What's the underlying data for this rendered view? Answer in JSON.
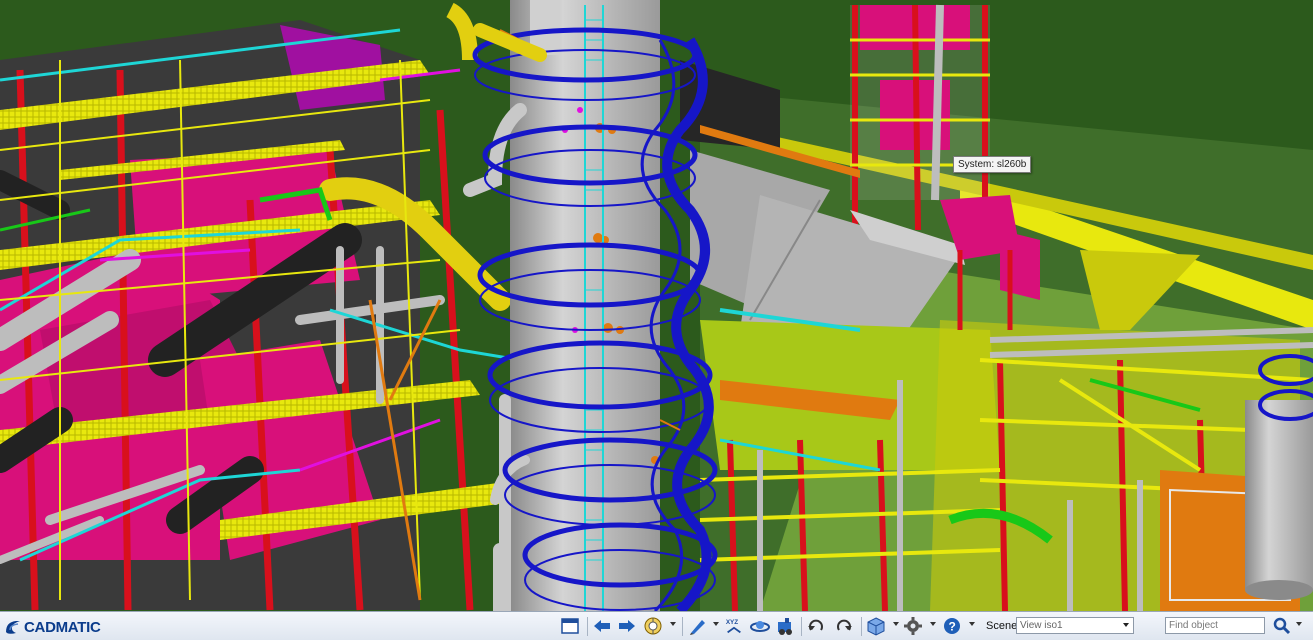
{
  "viewport": {
    "tooltip_text": "System: sl260b",
    "colors": {
      "background": "#2c5a1c",
      "ground": "#3f6e2a",
      "steel_red": "#d8101c",
      "equipment_magenta": "#d8107a",
      "platform_yellow": "#e8e80e",
      "handrail_blue": "#1616c8",
      "pipe_cyan": "#1ed6d6",
      "column_grey": "#b8b8b8",
      "walkway_orange": "#e08a1a"
    }
  },
  "statusbar": {
    "logo_text": "CADMATIC",
    "toolbar_icons": [
      "window-icon",
      "arrow-left-icon",
      "arrow-right-icon",
      "navigation-mode-icon",
      "measure-pen-icon",
      "xyz-coordinates-icon",
      "orbit-icon",
      "walk-icon",
      "undo-view-icon",
      "redo-view-icon",
      "object-box-icon",
      "settings-gear-icon",
      "help-icon"
    ],
    "xyz_label": "XYZ",
    "scene_label": "Scene:",
    "scene_value": "View iso1",
    "find_placeholder": "Find object",
    "search_icon": "magnifier-icon"
  }
}
